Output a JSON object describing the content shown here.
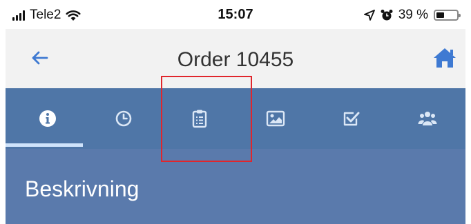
{
  "status_bar": {
    "carrier": "Tele2",
    "time": "15:07",
    "battery": "39 %",
    "battery_level": 0.39
  },
  "header": {
    "title": "Order 10455",
    "back_icon": "back-arrow-icon",
    "home_icon": "home-icon"
  },
  "tabs": [
    {
      "icon": "info-icon",
      "selected": true
    },
    {
      "icon": "clock-icon",
      "selected": false
    },
    {
      "icon": "clipboard-icon",
      "selected": false,
      "highlighted": true
    },
    {
      "icon": "image-icon",
      "selected": false
    },
    {
      "icon": "checkbox-icon",
      "selected": false
    },
    {
      "icon": "users-icon",
      "selected": false
    }
  ],
  "section": {
    "title": "Beskrivning"
  },
  "colors": {
    "tab_bar": "#4f76a7",
    "section": "#5a7aac",
    "accent": "#3f7ad2",
    "highlight_box": "#e0262c"
  }
}
